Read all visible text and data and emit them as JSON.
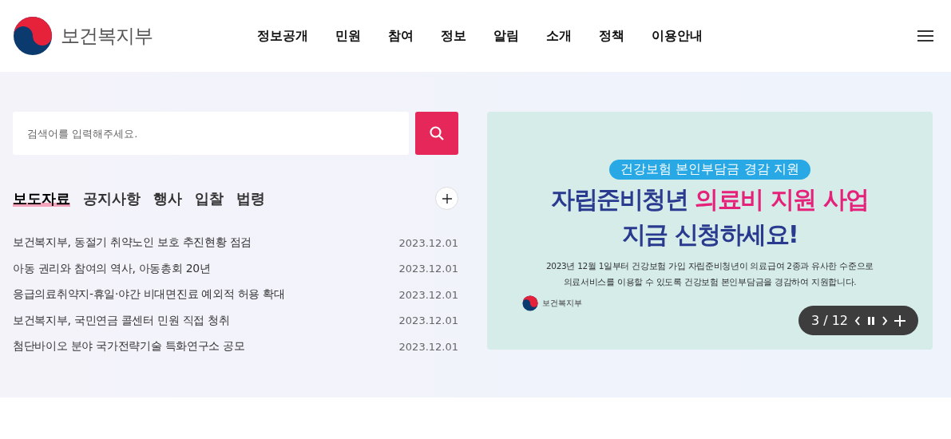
{
  "header": {
    "logo_text": "보건복지부",
    "nav": [
      "정보공개",
      "민원",
      "참여",
      "정보",
      "알림",
      "소개",
      "정책",
      "이용안내"
    ]
  },
  "search": {
    "placeholder": "검색어를 입력해주세요."
  },
  "tabs": [
    {
      "label": "보도자료",
      "selected": true
    },
    {
      "label": "공지사항",
      "selected": false
    },
    {
      "label": "행사",
      "selected": false
    },
    {
      "label": "입찰",
      "selected": false
    },
    {
      "label": "법령",
      "selected": false
    }
  ],
  "news": [
    {
      "title": "보건복지부, 동절기 취약노인 보호 추진현황 점검",
      "date": "2023.12.01"
    },
    {
      "title": "아동 권리와 참여의 역사, 아동총회 20년",
      "date": "2023.12.01"
    },
    {
      "title": "응급의료취약지-휴일·야간 비대면진료 예외적 허용 확대",
      "date": "2023.12.01"
    },
    {
      "title": "보건복지부, 국민연금 콜센터 민원 직접 청취",
      "date": "2023.12.01"
    },
    {
      "title": "첨단바이오 분야 국가전략기술 특화연구소 공모",
      "date": "2023.12.01"
    }
  ],
  "banner": {
    "tag": "건강보험 본인부담금 경감 지원",
    "headline_1": "자립준비청년",
    "headline_2": "의료비 지원 사업",
    "headline_3": "지금 신청하세요!",
    "body": [
      "2023년 12월 1일부터 건강보험 가입 자립준비청년이 의료급여 2종과 유사한 수준으로",
      "의료서비스를 이용할 수 있도록 건강보험 본인부담금을 경감하여 지원합니다."
    ],
    "logo_text": "보건복지부",
    "counter": "3 / 12"
  }
}
